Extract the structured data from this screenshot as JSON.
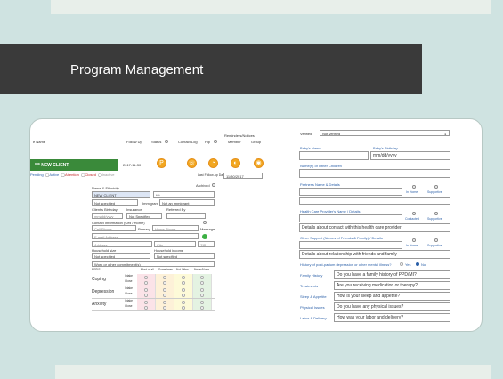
{
  "slide": {
    "title": "Program Management"
  },
  "left": {
    "name_label": "e Name",
    "followup_label": "Follow Up",
    "status_label": "Status",
    "contact_log_label": "Contact Log",
    "hip_label": "Hip",
    "reminders_label": "Reminders/Notices",
    "member_label": "Member",
    "group_label": "Group",
    "client_name": "*** NEW CLIENT",
    "followup_value": "2017-11-30",
    "last_follow_label": "Last Follow-up Date",
    "last_follow_value": "11/30/2017",
    "status_options": [
      "Pending",
      "Active",
      "Attention",
      "Closed",
      "Inactive"
    ],
    "archived_label": "Archived",
    "name_eth_label": "Name & Ethnicity",
    "name_value": "NEW CLIENT",
    "name_value2": "***",
    "spec1": "Not specified",
    "immigrant_label": "Immigrant",
    "spec2": "Not an immigrant",
    "birthday_label": "Client's Birthday",
    "insurance_label": "Insurance",
    "referred_label": "Referred By",
    "birthday_ph": "mm/dd/yyyy",
    "insurance_value": "Not Specified",
    "contact_label": "Contact Information (Cell / Home)",
    "cell_ph": "Cell Phone",
    "primary_label": "Primary",
    "home_ph": "Home Phone",
    "message_label": "Message",
    "email_ph": "E-mail Address",
    "address_ph": "Address",
    "city_ph": "City",
    "zip_ph": "ZIP",
    "household_size_label": "Household size",
    "household_income_label": "Household income",
    "hs_value": "Not specified",
    "hi_value": "Not specified",
    "work_ph": "Work or other commitment(s)",
    "grid_label": "EPDS",
    "grid_cols": [
      "Most or all",
      "Sometimes",
      "Not Often",
      "Never/None"
    ],
    "grid_rows": [
      {
        "label": "Coping",
        "sub": [
          "Intake",
          "Close"
        ]
      },
      {
        "label": "Depression",
        "sub": [
          "Intake",
          "Close"
        ]
      },
      {
        "label": "Anxiety",
        "sub": [
          "Intake",
          "Close"
        ]
      }
    ]
  },
  "right": {
    "verified_label": "Verified",
    "verified_value": "Not verified",
    "baby_name_label": "Baby's Name",
    "baby_bday_label": "Baby's Birthday",
    "baby_bday_ph": "mm/dd/yyyy",
    "other_children_label": "Name(s) of Other Children",
    "partner_label": "Partner's Name & Details",
    "in_home_label": "In Home",
    "supportive_label": "Supportive",
    "hcp_label": "Health Care Provider's Name / Details",
    "contacted_label": "Contacted",
    "hcp_ph": "Details about contact with this health care provider",
    "other_support_label": "Other Support (Names of Friends & Family) / Details",
    "other_ph": "Details about relationship with friends and family",
    "history_label": "History of post-partum depression or other mental illness?",
    "yes_label": "Yes",
    "no_label": "No",
    "qa": [
      {
        "label": "Family History",
        "q": "Do you have a family history of PPD/MI?"
      },
      {
        "label": "Treatments",
        "q": "Are you receiving medication or therapy?"
      },
      {
        "label": "Sleep & Appetite",
        "q": "How is your sleep and appetite?"
      },
      {
        "label": "Physical Issues",
        "q": "Do you have any physical issues?"
      },
      {
        "label": "Labor & Delivery",
        "q": "How was your labor and delivery?"
      }
    ]
  },
  "colors": {
    "slide_bg": "#cfe3e1",
    "title_bar": "#3a3a3a",
    "client_green": "#3a8a3a",
    "icon_orange": "#f2a720",
    "link_blue": "#2a5fa8"
  }
}
